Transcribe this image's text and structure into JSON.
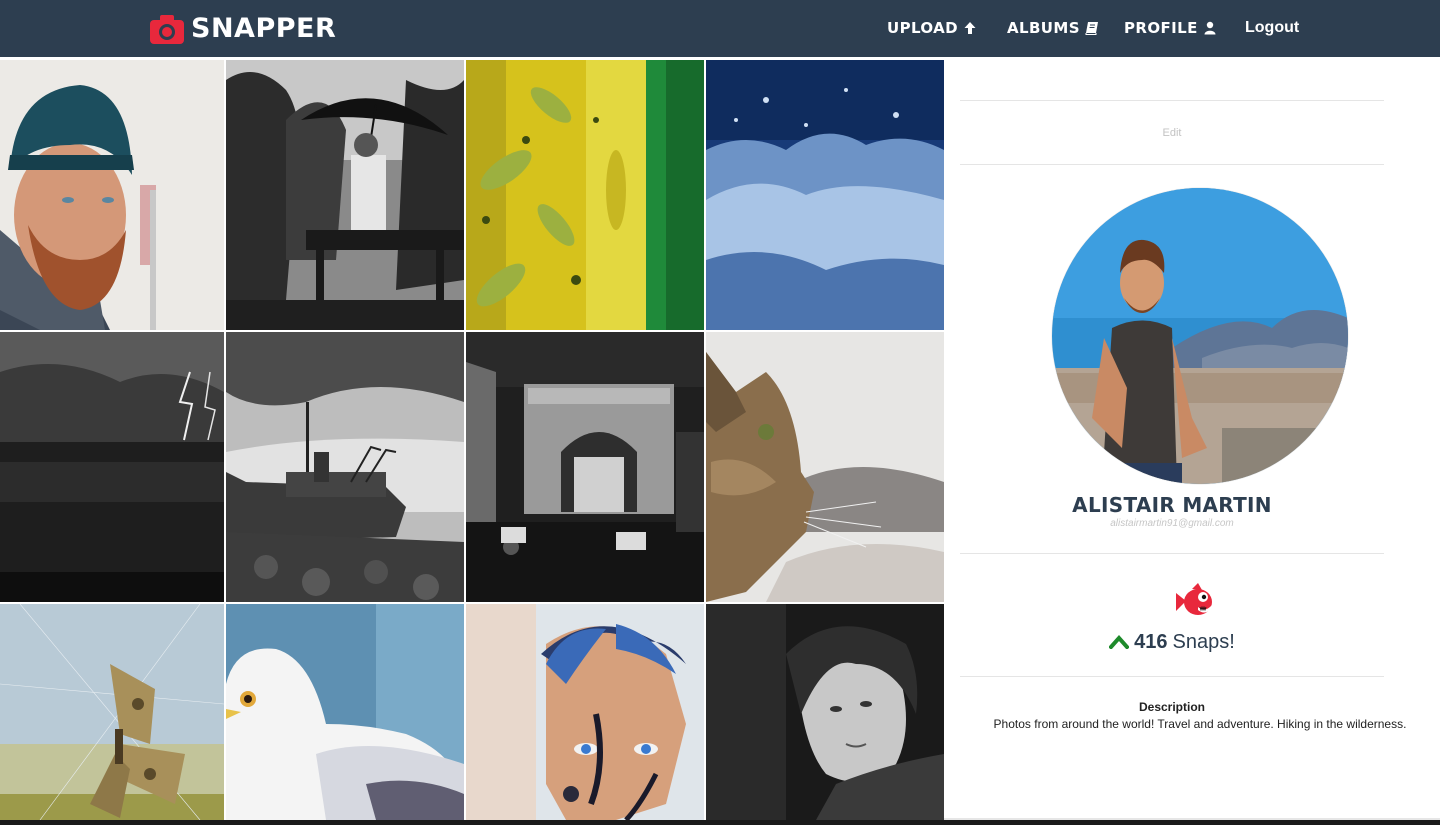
{
  "navbar": {
    "brand": "SNAPPER",
    "brand_icon": "camera-icon",
    "upload_label": "UPLOAD",
    "upload_icon": "arrow-up-icon",
    "albums_label": "ALBUMS",
    "albums_icon": "book-icon",
    "profile_label": "PROFILE",
    "profile_icon": "user-icon",
    "logout_label": "Logout",
    "background": "#2d3e50",
    "accent": "#e8283c"
  },
  "gallery": {
    "photos": [
      {
        "subject": "bearded man in beanie"
      },
      {
        "subject": "woman with umbrella on bench"
      },
      {
        "subject": "yellow green leaves abstract"
      },
      {
        "subject": "blue water splash"
      },
      {
        "subject": "lightning over sea"
      },
      {
        "subject": "shipwreck on rocks"
      },
      {
        "subject": "stone arch with scooters"
      },
      {
        "subject": "cat profile"
      },
      {
        "subject": "butterfly in web"
      },
      {
        "subject": "white seagull"
      },
      {
        "subject": "painted face man"
      },
      {
        "subject": "woman portrait"
      }
    ]
  },
  "profile": {
    "edit_label": "Edit",
    "name": "ALISTAIR MARTIN",
    "email": "alistairmartin91@gmail.com",
    "mascot_icon": "red-fish-icon",
    "snaps_icon": "chevron-up-icon",
    "snaps_count": "416",
    "snaps_label": "Snaps!",
    "description_title": "Description",
    "description_text": "Photos from around the world! Travel and adventure. Hiking in the wilderness.",
    "accent_green": "#1e8a2b"
  }
}
